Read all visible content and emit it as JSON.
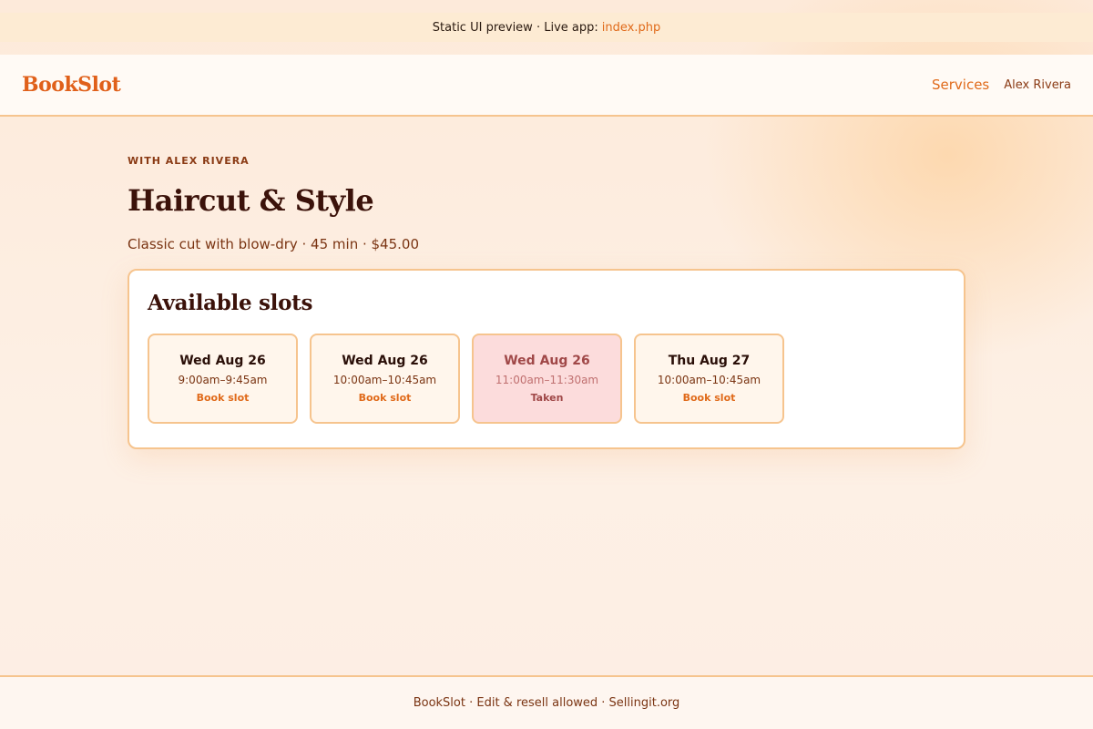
{
  "preview_bar": {
    "text": "Static UI preview · Live app:",
    "link": "index.php"
  },
  "header": {
    "logo": "BookSlot",
    "nav_services": "Services",
    "user_name": "Alex Rivera"
  },
  "service": {
    "eyebrow": "WITH ALEX RIVERA",
    "title": "Haircut & Style",
    "description": "Classic cut with blow-dry · 45 min · $45.00"
  },
  "slots_panel": {
    "title": "Available slots",
    "slots": [
      {
        "date": "Wed Aug 26",
        "time": "9:00am–9:45am",
        "action": "Book slot",
        "status": "available"
      },
      {
        "date": "Wed Aug 26",
        "time": "10:00am–10:45am",
        "action": "Book slot",
        "status": "available"
      },
      {
        "date": "Wed Aug 26",
        "time": "11:00am–11:30am",
        "action": "Taken",
        "status": "taken"
      },
      {
        "date": "Thu Aug 27",
        "time": "10:00am–10:45am",
        "action": "Book slot",
        "status": "available"
      }
    ]
  },
  "footer": {
    "text": "BookSlot · Edit & resell allowed · Sellingit.org"
  },
  "colors": {
    "accent": "#e06a1a",
    "border": "#f6c48e",
    "taken_bg": "#fcdcdc",
    "heading": "#3b120a"
  }
}
